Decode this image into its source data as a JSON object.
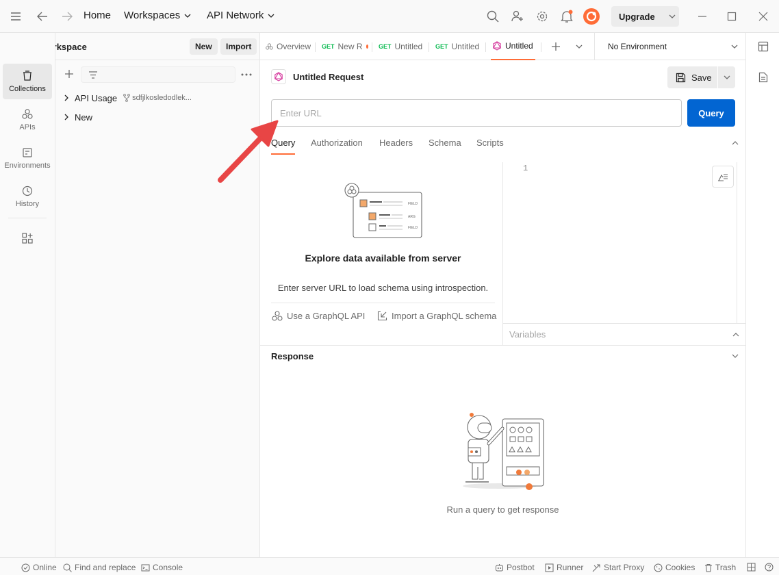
{
  "topbar": {
    "home": "Home",
    "workspaces": "Workspaces",
    "api_network": "API Network",
    "upgrade": "Upgrade"
  },
  "workspace": {
    "name": "My Workspace",
    "new_label": "New",
    "import_label": "Import"
  },
  "rail": {
    "items": [
      {
        "label": "Collections",
        "icon": "collections-icon"
      },
      {
        "label": "APIs",
        "icon": "apis-icon"
      },
      {
        "label": "Environments",
        "icon": "environments-icon"
      },
      {
        "label": "History",
        "icon": "history-icon"
      }
    ]
  },
  "sidebar": {
    "tree": [
      {
        "label": "API Usage",
        "fork_name": "sdfjlkosledodlek..."
      },
      {
        "label": "New"
      }
    ]
  },
  "tabs": [
    {
      "method": "",
      "label": "Overview"
    },
    {
      "method": "GET",
      "label": "New R"
    },
    {
      "method": "GET",
      "label": "Untitled"
    },
    {
      "method": "GET",
      "label": "Untitled"
    },
    {
      "method": "",
      "label": "Untitled"
    }
  ],
  "environment": {
    "selected": "No Environment"
  },
  "request": {
    "title": "Untitled Request",
    "save_label": "Save",
    "url_placeholder": "Enter URL",
    "url_value": "",
    "query_label": "Query",
    "subtabs": [
      "Query",
      "Authorization",
      "Headers",
      "Schema",
      "Scripts"
    ]
  },
  "explorer": {
    "title": "Explore data available from server",
    "description": "Enter server URL to load schema using introspection.",
    "use_api": "Use a GraphQL API",
    "import_schema": "Import a GraphQL schema",
    "illustration_text": [
      "FIELD",
      "ARG",
      "FIELD"
    ]
  },
  "editor": {
    "line_number": "1",
    "variables_label": "Variables"
  },
  "response": {
    "title": "Response",
    "empty_text": "Run a query to get response"
  },
  "statusbar": {
    "online": "Online",
    "find_replace": "Find and replace",
    "console": "Console",
    "postbot": "Postbot",
    "runner": "Runner",
    "start_proxy": "Start Proxy",
    "cookies": "Cookies",
    "trash": "Trash"
  },
  "colors": {
    "accent": "#ff6c37",
    "primary_button": "#0265d2",
    "annotation_arrow": "#e84545"
  }
}
